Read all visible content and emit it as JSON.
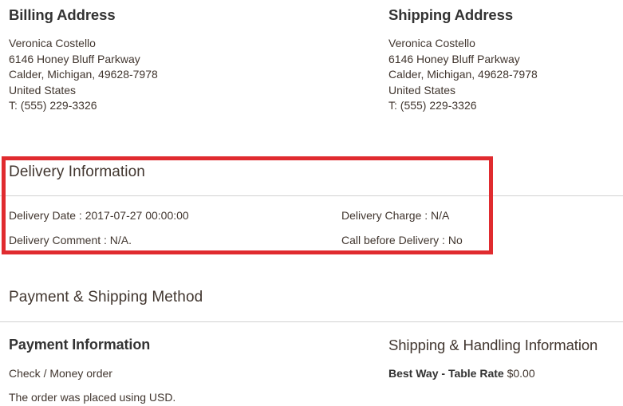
{
  "addresses": {
    "billing": {
      "title": "Billing Address",
      "lines": [
        "Veronica Costello",
        "6146 Honey Bluff Parkway",
        "Calder, Michigan, 49628-7978",
        "United States",
        "T: (555) 229-3326"
      ]
    },
    "shipping": {
      "title": "Shipping Address",
      "lines": [
        "Veronica Costello",
        "6146 Honey Bluff Parkway",
        "Calder, Michigan, 49628-7978",
        "United States",
        "T: (555) 229-3326"
      ]
    }
  },
  "delivery": {
    "title": "Delivery Information",
    "left": [
      "Delivery Date : 2017-07-27 00:00:00",
      "Delivery Comment : N/A."
    ],
    "right": [
      "Delivery Charge : N/A",
      "Call before Delivery : No"
    ],
    "fields": {
      "delivery_date_label": "Delivery Date :",
      "delivery_date_value": "2017-07-27 00:00:00",
      "delivery_comment_label": "Delivery Comment :",
      "delivery_comment_value": "N/A.",
      "delivery_charge_label": "Delivery Charge :",
      "delivery_charge_value": "N/A",
      "call_before_delivery_label": "Call before Delivery :",
      "call_before_delivery_value": "No"
    },
    "highlight_color": "#e02b2f"
  },
  "payment_shipping": {
    "title": "Payment & Shipping Method",
    "payment": {
      "title": "Payment Information",
      "method": "Check / Money order",
      "currency_note": "The order was placed using USD."
    },
    "shipping": {
      "title": "Shipping & Handling Information",
      "method": "Best Way - Table Rate",
      "price": "$0.00"
    }
  },
  "colors": {
    "text": "#41362f",
    "heading": "#333333",
    "rule": "#d1d1d1",
    "highlight": "#e02b2f"
  }
}
